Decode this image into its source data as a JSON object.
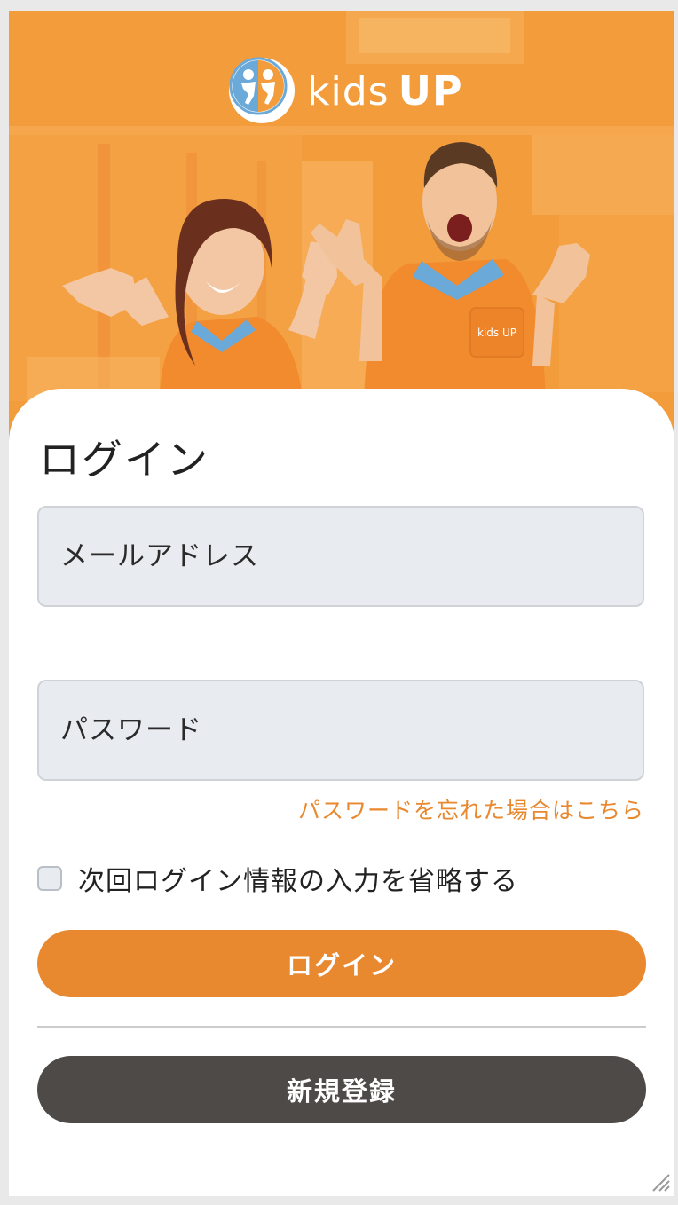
{
  "brand": {
    "logo_text_kids": "kids",
    "logo_text_up": "UP",
    "shirt_text": "kids UP"
  },
  "login_form": {
    "title": "ログイン",
    "email_placeholder": "メールアドレス",
    "password_placeholder": "パスワード",
    "forgot_password_link": "パスワードを忘れた場合はこちら",
    "remember_label": "次回ログイン情報の入力を省略する",
    "remember_checked": false,
    "login_button": "ログイン",
    "register_button": "新規登録"
  },
  "colors": {
    "accent": "#e8882f",
    "hero": "#f39c3c",
    "dark_button": "#4e4a48",
    "input_bg": "#e8ebef"
  },
  "icons": {
    "logo": "kids-up-logo-icon",
    "resize": "resize-handle-icon"
  }
}
